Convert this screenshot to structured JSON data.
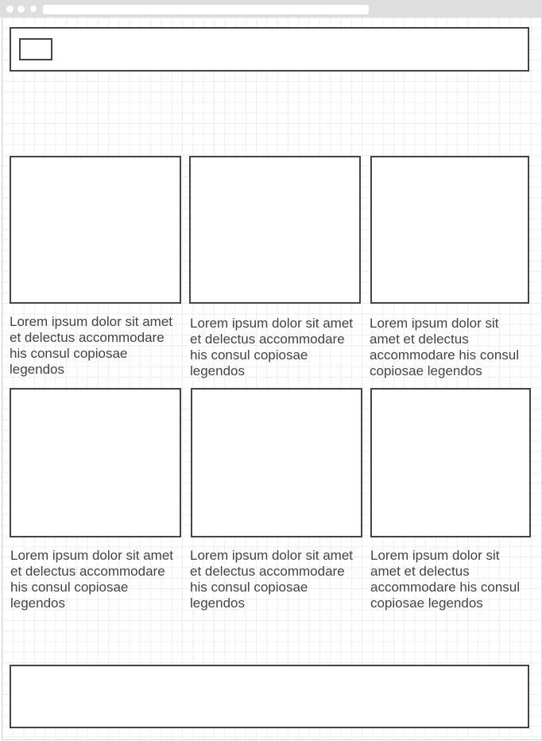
{
  "cards": [
    {
      "text": "Lorem ipsum dolor sit amet et delectus accommodare his consul copiosae legendos"
    },
    {
      "text": "Lorem ipsum dolor sit amet et delectus accommodare his consul copiosae legendos"
    },
    {
      "text": "Lorem ipsum dolor sit amet et delectus accommodare his consul copiosae legendos"
    },
    {
      "text": "Lorem ipsum dolor sit amet et delectus accommodare his consul copiosae legendos"
    },
    {
      "text": "Lorem ipsum dolor sit amet et delectus accommodare his consul copiosae legendos"
    },
    {
      "text": "Lorem ipsum dolor sit amet et delectus accommodare his consul copiosae legendos"
    }
  ]
}
